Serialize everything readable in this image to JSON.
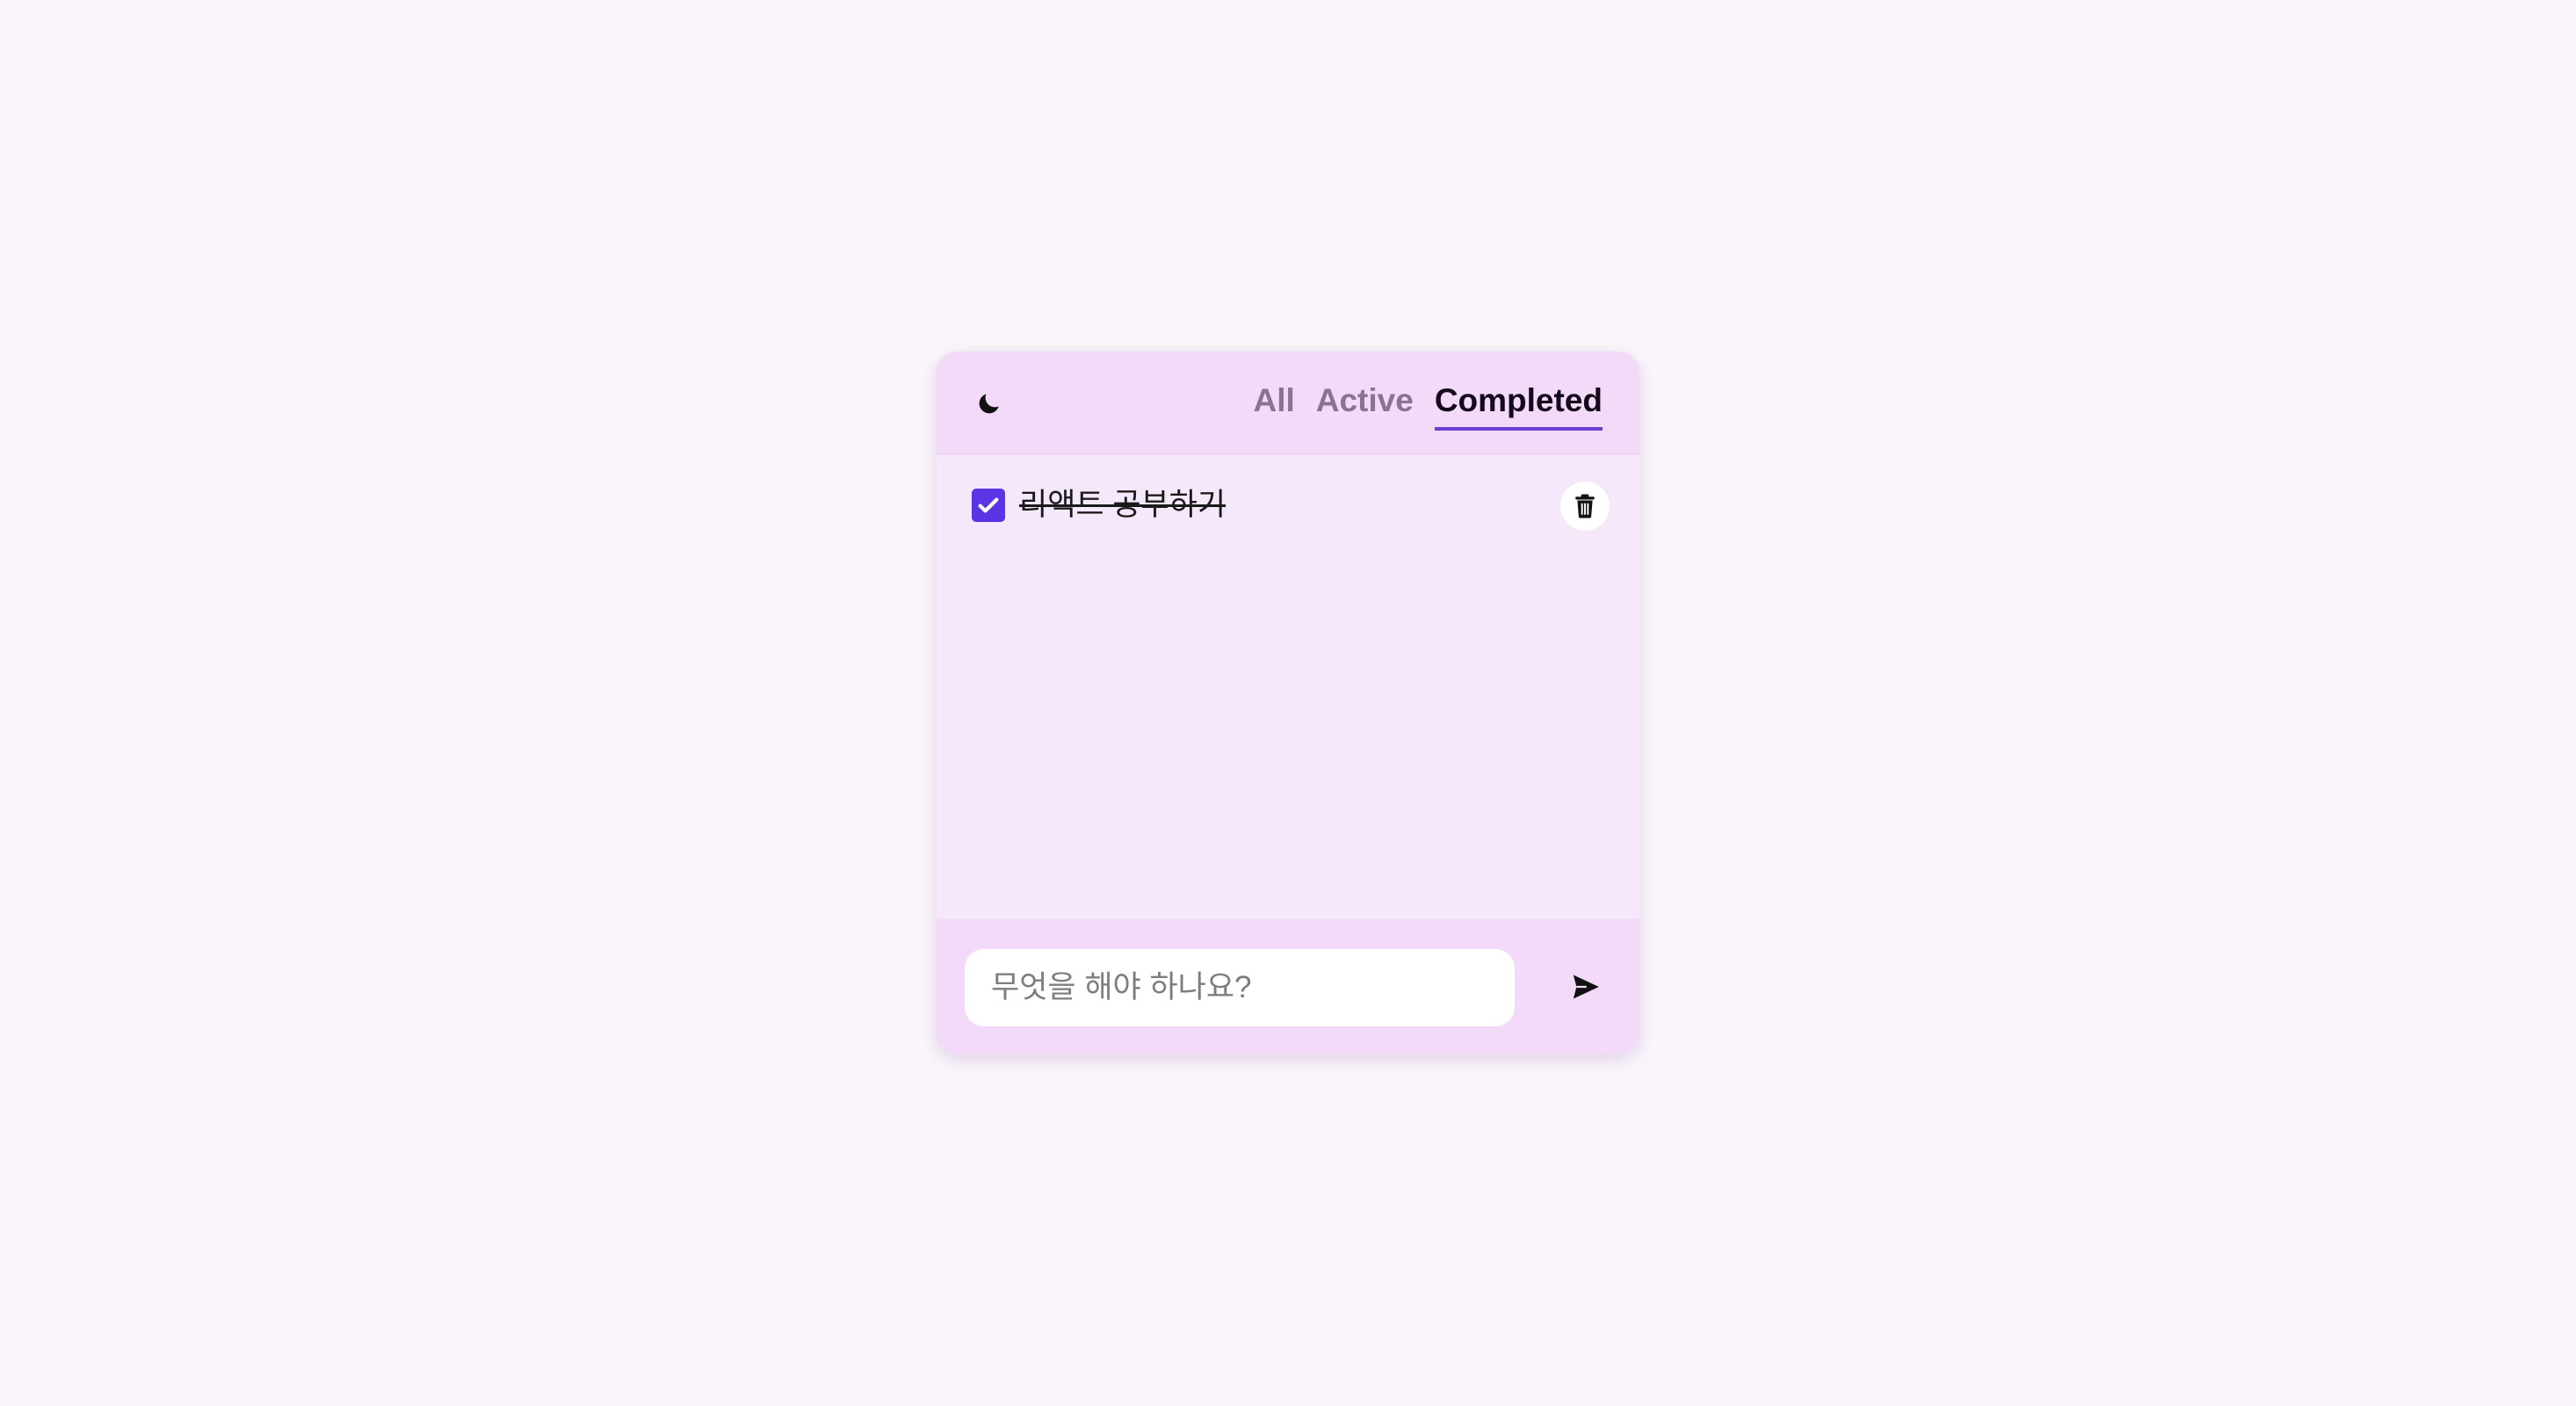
{
  "app": {
    "theme_icon": "moon-icon"
  },
  "filters": {
    "selected": "Completed",
    "items": [
      {
        "label": "All"
      },
      {
        "label": "Active"
      },
      {
        "label": "Completed"
      }
    ]
  },
  "todos": [
    {
      "text": "리액트 공부하기",
      "completed": true,
      "delete_icon": "trash-icon"
    }
  ],
  "input": {
    "placeholder": "무엇을 해야 하나요?",
    "value": "",
    "send_icon": "send-icon"
  },
  "colors": {
    "accent": "#5a35e6",
    "tab_underline": "#6a3fd0",
    "header_bg": "#f3daf9",
    "list_bg": "#f5e8fb",
    "page_bg": "#fbf6fc"
  }
}
